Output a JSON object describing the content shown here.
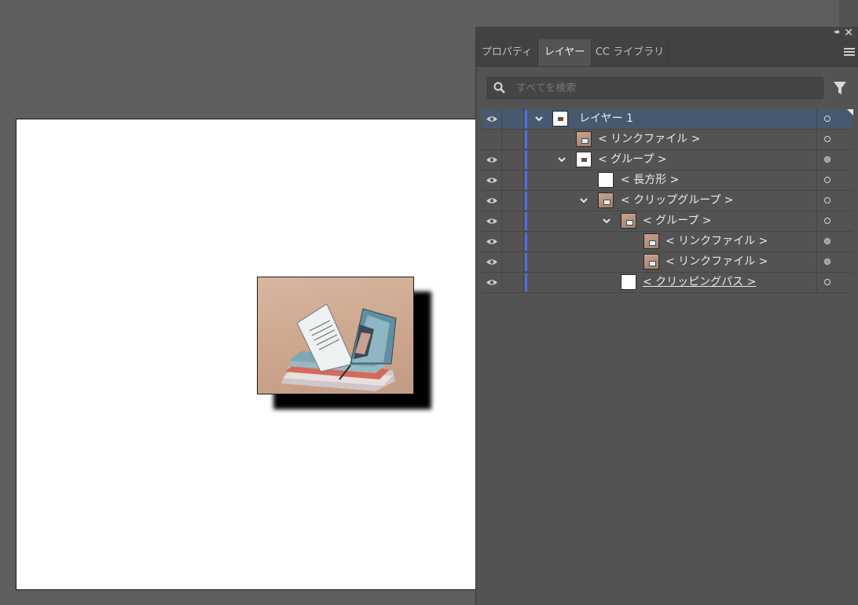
{
  "panel": {
    "tabs": [
      {
        "label": "プロパティ"
      },
      {
        "label": "レイヤー"
      },
      {
        "label": "CC ライブラリ"
      }
    ],
    "active_tab": "レイヤー",
    "search": {
      "placeholder": "すべてを検索",
      "value": ""
    },
    "layers": [
      {
        "name": "レイヤー 1",
        "visible": true,
        "expanded": true,
        "depth": 0,
        "selected": true,
        "target": "hollow"
      },
      {
        "name": "< リンクファイル >",
        "visible": false,
        "depth": 1,
        "target": "hollow"
      },
      {
        "name": "< グループ >",
        "visible": true,
        "expanded": true,
        "depth": 1,
        "target": "filled"
      },
      {
        "name": "< 長方形 >",
        "visible": true,
        "depth": 2,
        "target": "hollow"
      },
      {
        "name": "< クリップグループ >",
        "visible": true,
        "expanded": true,
        "depth": 2,
        "target": "hollow"
      },
      {
        "name": "< グループ >",
        "visible": true,
        "expanded": true,
        "depth": 3,
        "target": "hollow"
      },
      {
        "name": "< リンクファイル >",
        "visible": true,
        "depth": 4,
        "target": "filled"
      },
      {
        "name": "< リンクファイル >",
        "visible": true,
        "depth": 4,
        "target": "filled"
      },
      {
        "name": "< クリッピングパス >",
        "visible": true,
        "depth": 3,
        "underline": true,
        "target": "hollow"
      }
    ]
  },
  "colors": {
    "workspace": "#5e5e5e",
    "panel_bg": "#535353",
    "selection": "#46596f",
    "layer_color": "#4f6ee8"
  },
  "icons": [
    "collapse-panel-icon",
    "close-icon",
    "panel-menu-icon",
    "search-icon",
    "filter-icon",
    "eye-icon",
    "chevron-down-icon"
  ]
}
